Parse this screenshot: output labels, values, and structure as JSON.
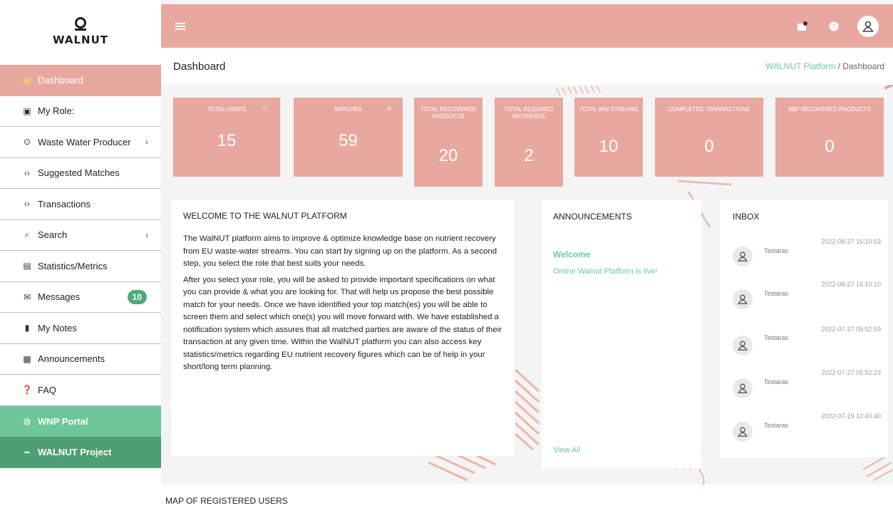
{
  "brand": {
    "logo_text": "WALNUT"
  },
  "sidebar": {
    "items": [
      {
        "label": "Dashboard",
        "icon": "dashboard-icon"
      },
      {
        "label": "My Role:",
        "icon": "id-card-icon"
      },
      {
        "label": "Waste Water Producer",
        "icon": "radio-icon"
      },
      {
        "label": "Suggested Matches",
        "icon": "code-arrows-icon"
      },
      {
        "label": "Transactions",
        "icon": "code-arrows-icon"
      },
      {
        "label": "Search",
        "icon": "search-icon"
      },
      {
        "label": "Statistics/Metrics",
        "icon": "chart-icon"
      },
      {
        "label": "Messages",
        "icon": "envelope-icon",
        "badge": "10"
      },
      {
        "label": "My Notes",
        "icon": "bookmark-icon"
      },
      {
        "label": "Announcements",
        "icon": "megaphone-icon"
      },
      {
        "label": "FAQ",
        "icon": "question-icon"
      },
      {
        "label": "WNP Portal",
        "icon": "globe-icon"
      },
      {
        "label": "WALNUT Project",
        "icon": "walnut-mini-icon"
      }
    ]
  },
  "header": {
    "title": "Dashboard",
    "breadcrumb_link": "WALNUT Platform",
    "breadcrumb_sep": "/",
    "breadcrumb_current": "Dashboard"
  },
  "stats": [
    {
      "label": "TOTAL USERS",
      "value": "15"
    },
    {
      "label": "MATCHES",
      "value": "59"
    },
    {
      "label": "TOTAL RECOVERED PRODUCTS",
      "value": "20"
    },
    {
      "label": "TOTAL REQUIRED NUTRIENTS",
      "value": "2"
    },
    {
      "label": "TOTAL WW STREAMS",
      "value": "10"
    },
    {
      "label": "COMPLETED TRANSACTIONS",
      "value": "0"
    },
    {
      "label": "BBF RECOVERED PRODUCTS",
      "value": "0"
    }
  ],
  "welcome": {
    "title": "WELCOME TO THE WALNUT PLATFORM",
    "p1": "The WalNUT platform aims to improve & optimize knowledge base on nutrient recovery from EU waste-water streams. You can start by signing up on the platform. As a second step, you select the role that best suits your needs.",
    "p2": "After you select your role, you will be asked to provide important specifications on what you can provide & what you are looking for. That will help us propose the best possible match for your needs. Once we have identified your top match(es) you will be able to screen them and select which one(s) you will move forward with.  We have established a notification system which assures that all matched parties are aware of the status of their transaction at any given time. Within the WalNUT platform you can also access key statistics/metrics regarding EU nutrient recovery figures which can be of help in your short/long term planning."
  },
  "announcements": {
    "title": "ANNOUNCEMENTS",
    "item_title": "Welcome",
    "item_text": "Online Walnut Platform is live!",
    "view_all": "View All"
  },
  "inbox": {
    "title": "INBOX",
    "items": [
      {
        "sender": "Testaras",
        "date": "2022-08-27 16:10:53"
      },
      {
        "sender": "Testaras",
        "date": "2022-08-27 16:10:10"
      },
      {
        "sender": "Testaras",
        "date": "2022-07-27 05:52:59"
      },
      {
        "sender": "Testaras",
        "date": "2022-07-27 05:52:23"
      },
      {
        "sender": "Testaras",
        "date": "2022-07-19 12:40:40"
      }
    ]
  },
  "map": {
    "title": "MAP OF REGISTERED USERS"
  },
  "colors": {
    "accent": "#e8a89f",
    "green_light": "#6ec79b",
    "green_dark": "#4e9f73"
  }
}
